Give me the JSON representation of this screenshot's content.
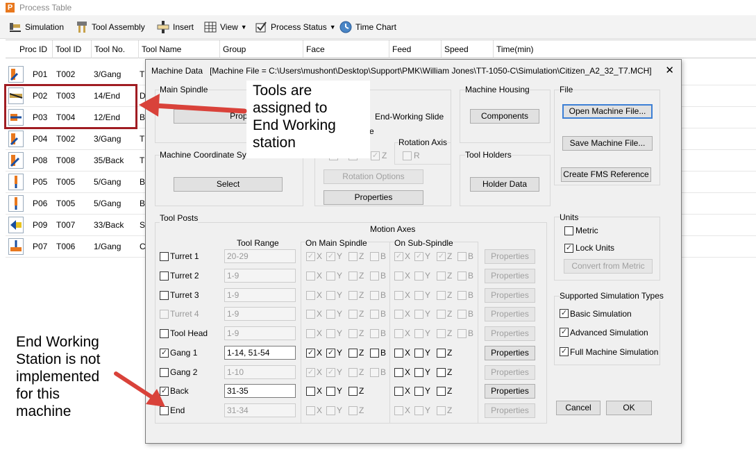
{
  "window": {
    "title": "Process Table"
  },
  "toolbar": {
    "simulation": "Simulation",
    "tool_assembly": "Tool Assembly",
    "insert": "Insert",
    "view": "View",
    "process_status": "Process Status",
    "time_chart": "Time Chart"
  },
  "columns": [
    "Proc ID",
    "Tool ID",
    "Tool No.",
    "Tool Name",
    "Group",
    "Face",
    "Feed",
    "Speed",
    "Time(min)"
  ],
  "rows": [
    {
      "proc": "P01",
      "tool": "T002",
      "no": "3/Gang",
      "name": "T"
    },
    {
      "proc": "P02",
      "tool": "T003",
      "no": "14/End",
      "name": "D"
    },
    {
      "proc": "P03",
      "tool": "T004",
      "no": "12/End",
      "name": "B"
    },
    {
      "proc": "P04",
      "tool": "T002",
      "no": "3/Gang",
      "name": "T"
    },
    {
      "proc": "P08",
      "tool": "T008",
      "no": "35/Back",
      "name": "T"
    },
    {
      "proc": "P05",
      "tool": "T005",
      "no": "5/Gang",
      "name": "B"
    },
    {
      "proc": "P06",
      "tool": "T005",
      "no": "5/Gang",
      "name": "B"
    },
    {
      "proc": "P09",
      "tool": "T007",
      "no": "33/Back",
      "name": "Sp"
    },
    {
      "proc": "P07",
      "tool": "T006",
      "no": "1/Gang",
      "name": "C"
    }
  ],
  "dialog": {
    "title": "Machine Data",
    "file_label": "[Machine File = C:\\Users\\mushont\\Desktop\\Support\\PMK\\William Jones\\TT-1050-C\\Simulation\\Citizen_A2_32_T7.MCH]",
    "close": "✕",
    "main_spindle": "Main Spindle",
    "properties": "Properties",
    "machine_coord": "Machine Coordinate Syste",
    "select": "Select",
    "end_working_slide": "End-Working Slide",
    "partial_e": "e",
    "rotation_axis": "Rotation Axis",
    "axis_z": "Z",
    "axis_r": "R",
    "rotation_options": "Rotation Options",
    "machine_housing": "Machine Housing",
    "components": "Components",
    "tool_holders": "Tool Holders",
    "holder_data": "Holder Data",
    "file_group": "File",
    "open_file": "Open Machine File...",
    "save_file": "Save Machine File...",
    "create_fms": "Create FMS Reference",
    "tool_posts": "Tool Posts",
    "motion_axes": "Motion Axes",
    "tool_range": "Tool Range",
    "on_main": "On Main Spindle",
    "on_sub": "On Sub-Spindle",
    "axis_labels": [
      "X",
      "Y",
      "Z",
      "B"
    ],
    "posts": [
      {
        "name": "Turret 1",
        "range": "20-29"
      },
      {
        "name": "Turret 2",
        "range": "1-9"
      },
      {
        "name": "Turret 3",
        "range": "1-9"
      },
      {
        "name": "Turret 4",
        "range": "1-9"
      },
      {
        "name": "Tool Head",
        "range": "1-9"
      },
      {
        "name": "Gang 1",
        "range": "1-14, 51-54"
      },
      {
        "name": "Gang 2",
        "range": "1-10"
      },
      {
        "name": "Back",
        "range": "31-35"
      },
      {
        "name": "End",
        "range": "31-34"
      }
    ],
    "units": "Units",
    "metric": "Metric",
    "lock_units": "Lock Units",
    "convert": "Convert from Metric",
    "sim_types": "Supported Simulation Types",
    "basic_sim": "Basic Simulation",
    "adv_sim": "Advanced Simulation",
    "full_sim": "Full Machine Simulation",
    "cancel": "Cancel",
    "ok": "OK"
  },
  "annotations": {
    "a1": [
      "Tools are",
      "assigned to",
      "End Working",
      "station"
    ],
    "a2": [
      "End Working",
      "Station is not",
      "implemented",
      "for this",
      "machine"
    ]
  },
  "colors": {
    "highlight": "#a01c22",
    "arrow": "#d9423a",
    "button_default": "#3c7fd5"
  }
}
